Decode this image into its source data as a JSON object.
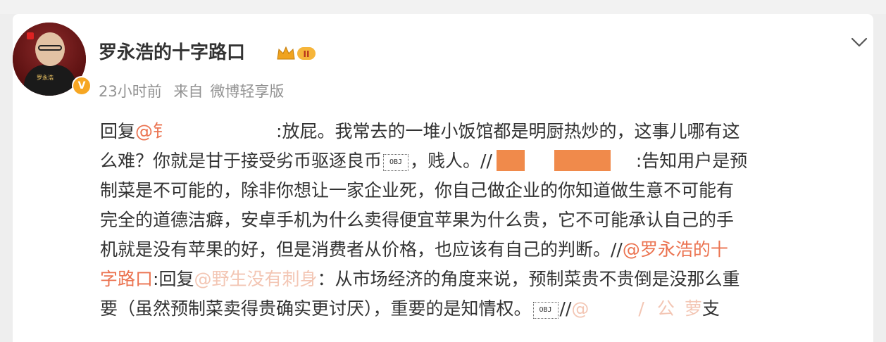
{
  "post": {
    "username": "罗永浩的十字路口",
    "level_badge": "II",
    "time": "23小时前",
    "source_prefix": "来自",
    "source": "微博轻享版",
    "avatar_caption": "罗永浩",
    "verified_mark": "V"
  },
  "content": {
    "l1_a": "回复",
    "l1_mention": "@钅",
    "l1_b": ":放屁。我常去的一堆小饭馆都是明厨热炒的，这事儿哪有这",
    "l2_a": "么难？你就是甘于接受劣币驱逐良币",
    "l2_obj": "OBJ",
    "l2_b": "，贱人。//",
    "l2_c": ":告知用户是预",
    "l3": "制菜是不可能的，除非你想让一家企业死，你自己做企业的你知道做生意不可能有",
    "l4": "完全的道德洁癖，安卓手机为什么卖得便宜苹果为什么贵，它不可能承认自己的手",
    "l5_a": "机就是没有苹果的好，但是消费者从价格，也应该有自己的判断。//",
    "l5_mention": "@罗永浩的十",
    "l6_mention": "字路口",
    "l6_a": ":回复",
    "l6_mention2": "@野生没有刺身",
    "l6_b": "：从市场经济的角度来说，预制菜贵不贵倒是没那么重",
    "l7_a": "要（虽然预制菜卖得贵确实更讨厌），重要的是知情权。",
    "l7_obj": "OBJ",
    "l7_b": "//",
    "l7_c": "@",
    "l7_d": "/",
    "l7_e": "公",
    "l7_f": "萝",
    "l7_g": "支"
  },
  "colors": {
    "link": "#eb7350",
    "text": "#333333",
    "meta": "#939393",
    "redaction_orange": "#f08a4b"
  },
  "icons": [
    "crown-icon",
    "chevron-down-icon",
    "verified-icon"
  ]
}
